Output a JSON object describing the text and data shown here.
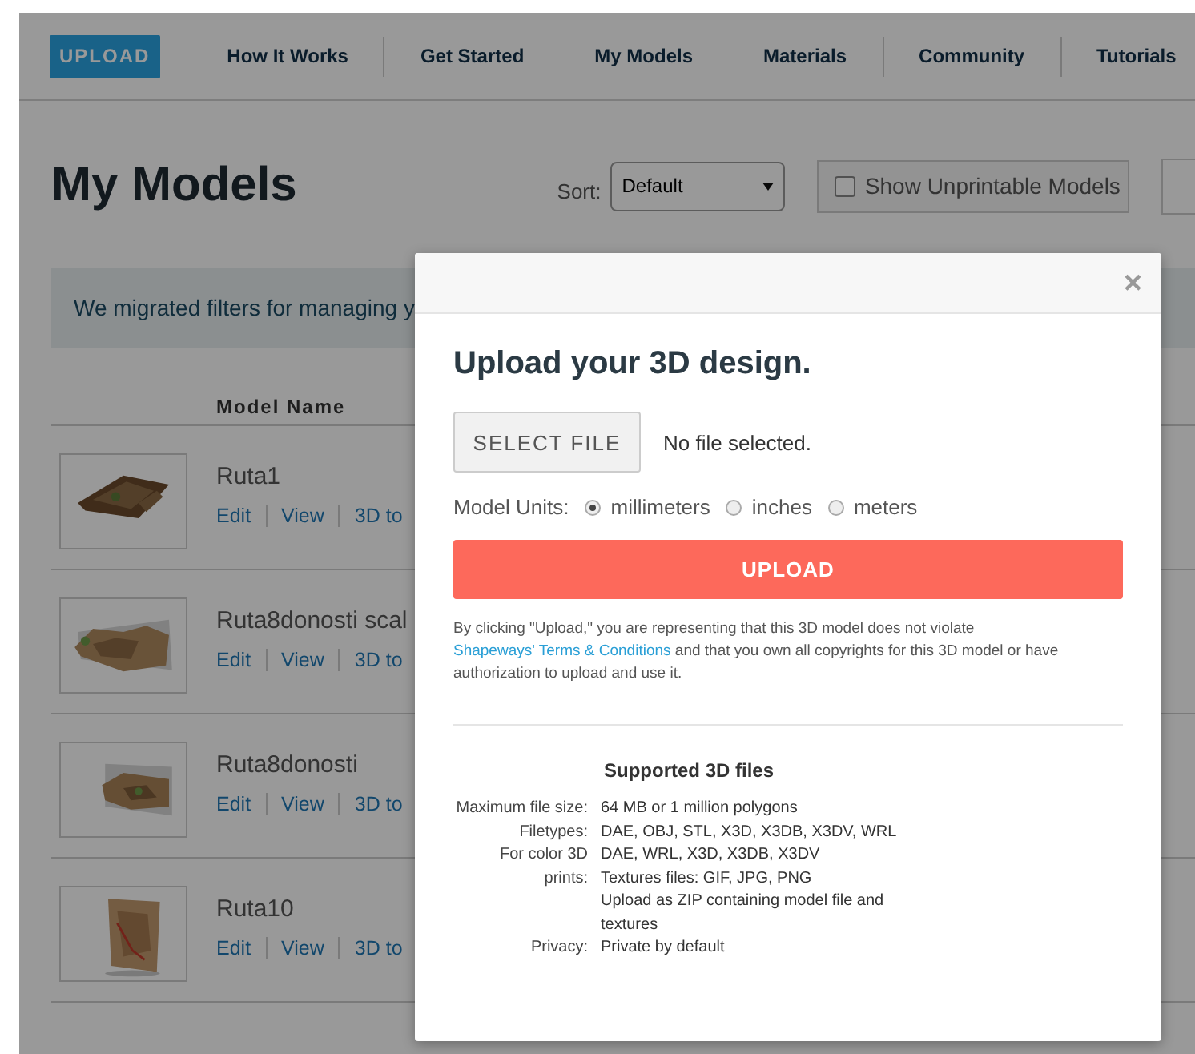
{
  "nav": {
    "upload_button": "UPLOAD",
    "items": [
      {
        "label": "How It Works",
        "divider_after": true
      },
      {
        "label": "Get Started",
        "divider_after": false
      },
      {
        "label": "My Models",
        "divider_after": false
      },
      {
        "label": "Materials",
        "divider_after": true
      },
      {
        "label": "Community",
        "divider_after": true
      },
      {
        "label": "Tutorials",
        "divider_after": false
      }
    ]
  },
  "page": {
    "title": "My Models",
    "sort_label": "Sort:",
    "sort_value": "Default",
    "unprintable": {
      "label": "Show Unprintable Models",
      "checked": false
    },
    "notice": "We migrated filters for managing y",
    "table_header": "Model Name",
    "models": [
      {
        "name": "Ruta1",
        "links": [
          "Edit",
          "View",
          "3D to"
        ]
      },
      {
        "name": "Ruta8donosti scal",
        "links": [
          "Edit",
          "View",
          "3D to"
        ]
      },
      {
        "name": "Ruta8donosti",
        "links": [
          "Edit",
          "View",
          "3D to"
        ]
      },
      {
        "name": "Ruta10",
        "links": [
          "Edit",
          "View",
          "3D to"
        ]
      }
    ]
  },
  "modal": {
    "close": "×",
    "title": "Upload your 3D design.",
    "select_file_button": "SELECT FILE",
    "file_status": "No file selected.",
    "units_label": "Model Units:",
    "units": [
      {
        "label": "millimeters",
        "selected": true
      },
      {
        "label": "inches",
        "selected": false
      },
      {
        "label": "meters",
        "selected": false
      }
    ],
    "upload_button": "UPLOAD",
    "legal": {
      "before": "By clicking \"Upload,\" you are representing that this 3D model does not violate",
      "link": "Shapeways' Terms & Conditions",
      "after": "and that you own all copyrights for this 3D model or have authorization to upload and use it."
    },
    "supported_title": "Supported 3D files",
    "specs": [
      {
        "label": "Maximum file size:",
        "values": [
          "64 MB or 1 million polygons"
        ]
      },
      {
        "label": "Filetypes:",
        "values": [
          "DAE, OBJ, STL, X3D, X3DB, X3DV, WRL"
        ]
      },
      {
        "label": "For color 3D prints:",
        "values": [
          "DAE, WRL, X3D, X3DB, X3DV",
          "Textures files: GIF, JPG, PNG",
          "Upload as ZIP containing model file and textures"
        ]
      },
      {
        "label": "Privacy:",
        "values": [
          "Private by default"
        ]
      }
    ]
  }
}
